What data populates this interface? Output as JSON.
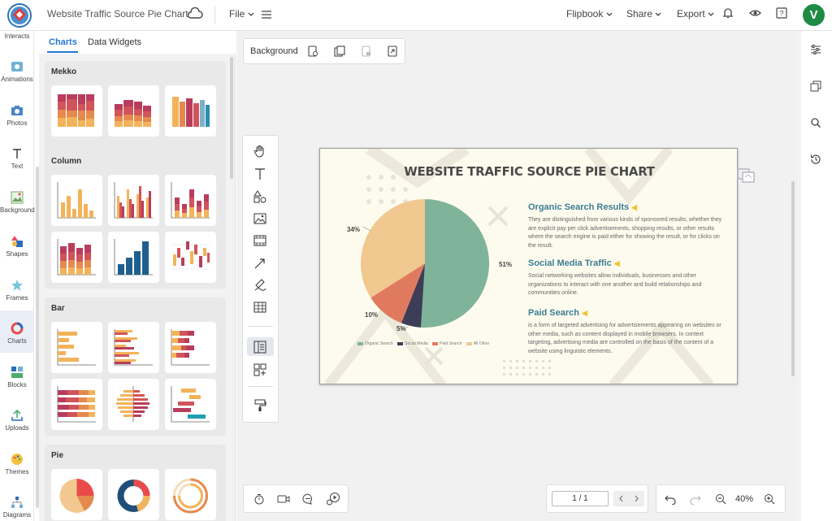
{
  "header": {
    "doc_title": "Website Traffic Source Pie Chart",
    "file_menu": "File",
    "flipbook_menu": "Flipbook",
    "share_menu": "Share",
    "export_menu": "Export",
    "avatar_letter": "V"
  },
  "rail": {
    "items": [
      {
        "label": "Interacts",
        "icon": "interacts-icon"
      },
      {
        "label": "Animations",
        "icon": "animations-icon"
      },
      {
        "label": "Photos",
        "icon": "photos-icon"
      },
      {
        "label": "Text",
        "icon": "text-icon"
      },
      {
        "label": "Background",
        "icon": "background-icon"
      },
      {
        "label": "Shapes",
        "icon": "shapes-icon"
      },
      {
        "label": "Frames",
        "icon": "frames-icon"
      },
      {
        "label": "Charts",
        "icon": "charts-icon",
        "active": true
      },
      {
        "label": "Blocks",
        "icon": "blocks-icon"
      },
      {
        "label": "Uploads",
        "icon": "uploads-icon"
      },
      {
        "label": "Themes",
        "icon": "themes-icon"
      },
      {
        "label": "Diagrams",
        "icon": "diagrams-icon"
      }
    ]
  },
  "panel": {
    "tabs": [
      "Charts",
      "Data Widgets"
    ],
    "active_tab": "Charts",
    "sections": [
      "Mekko",
      "Column",
      "Bar",
      "Pie"
    ]
  },
  "canvas": {
    "bg_toolbar_label": "Background",
    "page_indicator": "1 / 1",
    "zoom": "40%"
  },
  "slide": {
    "title": "WEBSITE TRAFFIC SOURCE PIE CHART",
    "sections": [
      {
        "heading": "Organic Search Results",
        "body": "They are distinguished from various kinds of sponsored results, whether they are explicit pay per click advertisements, shopping results, or other results where the search engine is paid either for showing the result, or for clicks on the result."
      },
      {
        "heading": "Social Media Traffic",
        "body": "Social networking websites allow individuals, businesses and other organizations to interact with one another and build relationships and communities online."
      },
      {
        "heading": "Paid Search",
        "body": "is a form of targeted advertising for advertisements appearing on websites or other media, such as content displayed in mobile browsers. In context targeting, advertising media are controlled on the basis of the content of a website using linguistic elements."
      }
    ]
  },
  "chart_data": {
    "type": "pie",
    "title": "WEBSITE TRAFFIC SOURCE PIE CHART",
    "categories": [
      "Organic Search",
      "Social Media",
      "Paid Search",
      "All Other"
    ],
    "values": [
      51,
      5,
      10,
      34
    ],
    "labels": [
      "51%",
      "5%",
      "10%",
      "34%"
    ],
    "colors": [
      "#7fb49a",
      "#3d3d57",
      "#e07a5f",
      "#f0c890"
    ],
    "legend_position": "bottom-left"
  },
  "colors": {
    "accent": "#2577d4",
    "heading": "#3a7d93",
    "avatar": "#1e8a44"
  }
}
